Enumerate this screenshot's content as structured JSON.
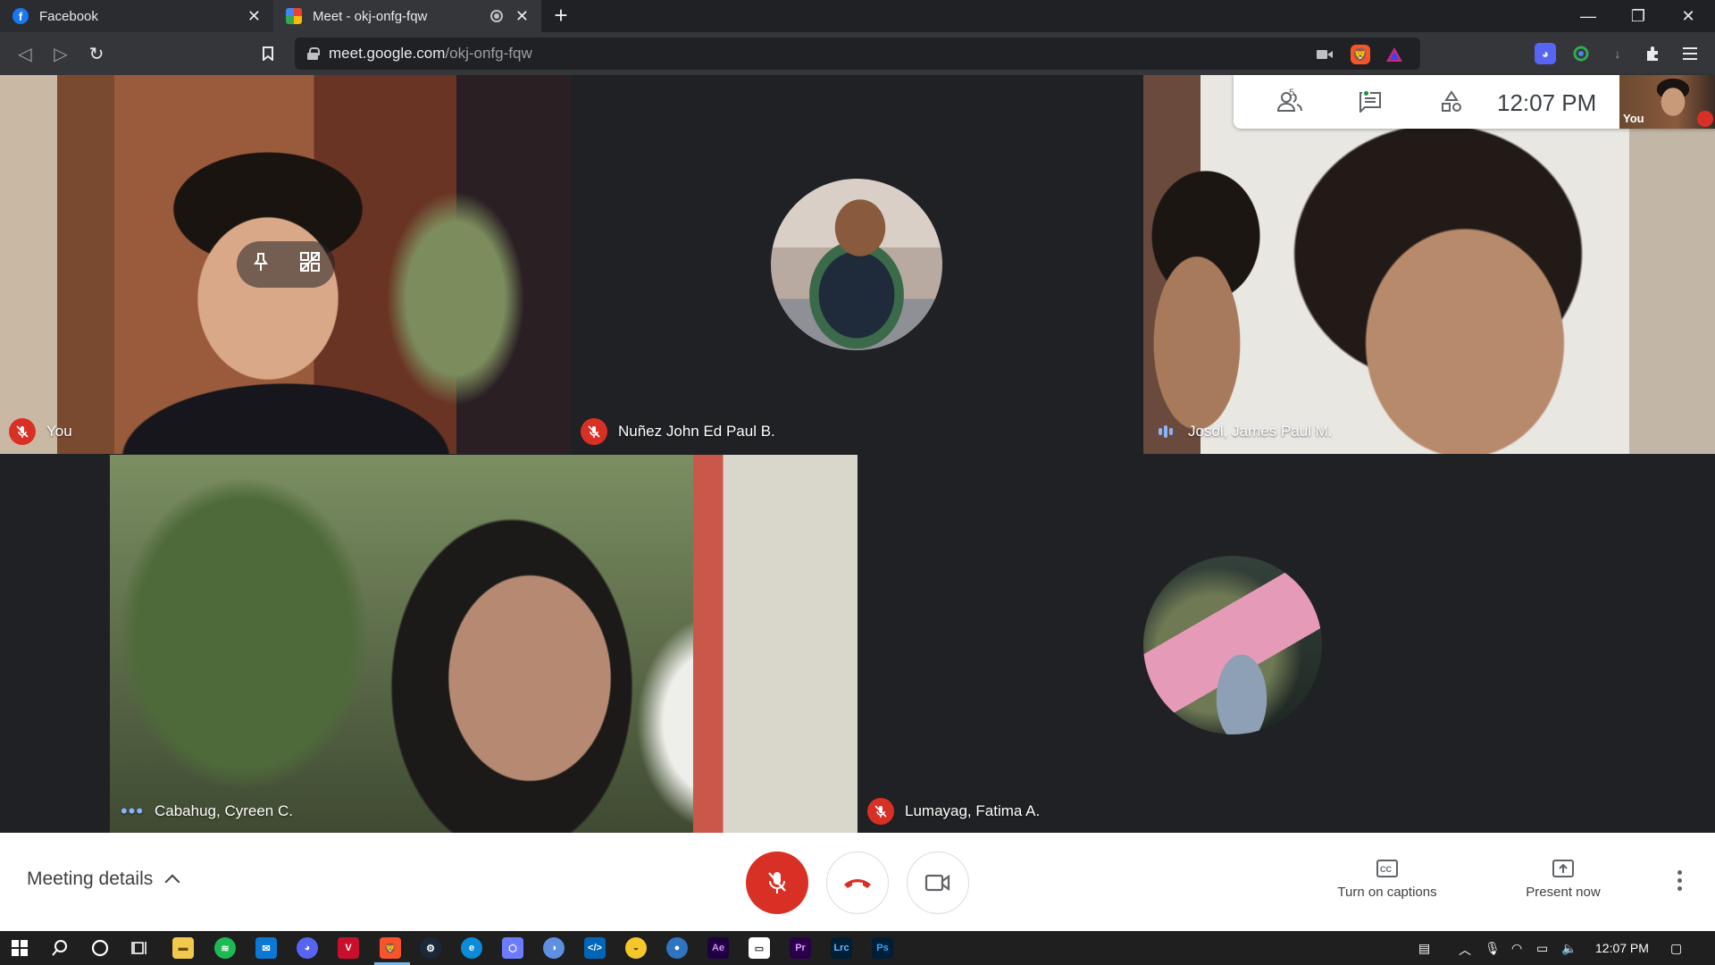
{
  "browser": {
    "tabs": [
      {
        "title": "Facebook"
      },
      {
        "title": "Meet - okj-onfg-fqw"
      }
    ],
    "url_host": "meet.google.com",
    "url_path": "/okj-onfg-fqw"
  },
  "meet": {
    "participant_count": "5",
    "clock": "12:07  PM",
    "self_view_label": "You",
    "tiles": [
      {
        "name": "You",
        "mic": "muted"
      },
      {
        "name": "Nuñez John Ed Paul B.",
        "mic": "muted"
      },
      {
        "name": "Josol, James Paul M.",
        "mic": "speaking"
      },
      {
        "name": "Cabahug, Cyreen C.",
        "mic": "active"
      },
      {
        "name": "Lumayag, Fatima A.",
        "mic": "muted"
      }
    ],
    "bottom": {
      "meeting_details": "Meeting details",
      "captions_label": "Turn on captions",
      "present_label": "Present now"
    }
  },
  "taskbar": {
    "time": "12:07 PM"
  },
  "colors": {
    "meet_red": "#d93025",
    "meet_blue": "#8ab4f8",
    "stage_bg": "#202124"
  }
}
